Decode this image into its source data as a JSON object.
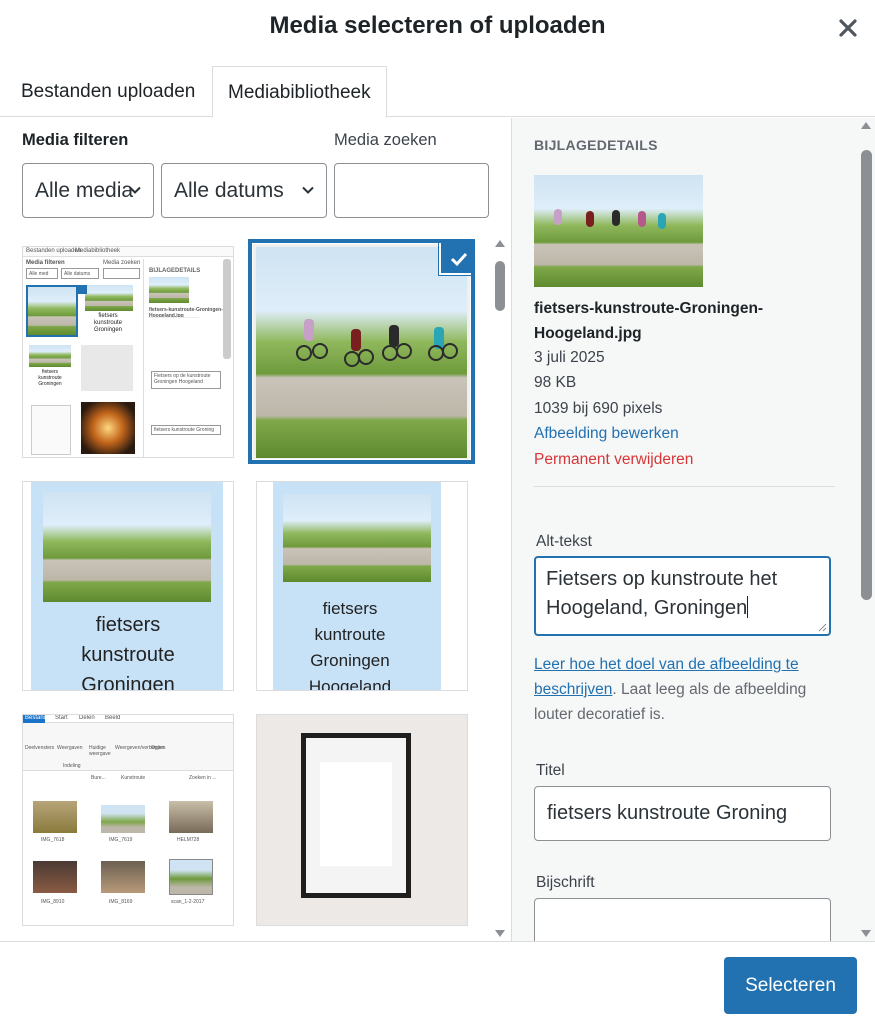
{
  "modal": {
    "title": "Media selecteren of uploaden",
    "close_icon": "close-icon"
  },
  "tabs": [
    {
      "label": "Bestanden uploaden",
      "active": false
    },
    {
      "label": "Mediabibliotheek",
      "active": true
    }
  ],
  "filters": {
    "filter_label": "Media filteren",
    "type_value": "Alle media",
    "date_value": "Alle datums",
    "search_label": "Media zoeken",
    "search_value": ""
  },
  "grid": {
    "items": [
      {
        "kind": "screenshot",
        "selected": false
      },
      {
        "kind": "photo-cyclists",
        "selected": true
      },
      {
        "kind": "poster",
        "text_lines": [
          "fietsers",
          "kunstroute",
          "Groningen"
        ],
        "selected": false
      },
      {
        "kind": "poster",
        "text_lines": [
          "fietsers",
          "kuntroute",
          "Groningen",
          "Hoogeland"
        ],
        "selected": false
      },
      {
        "kind": "explorer-screenshot",
        "selected": false
      },
      {
        "kind": "photo-frame",
        "selected": false
      }
    ],
    "explorer": {
      "tabs": [
        "Bestand",
        "Start",
        "Delen",
        "Beeld"
      ],
      "ribbon": [
        "Deelvensters",
        "Weergaven",
        "Huidige weergave",
        "Weergeven/verbergen",
        "Opties"
      ],
      "ribbon_group": "Indeling",
      "path": [
        "Bure...",
        "Kunstroute"
      ],
      "search": "Zoeken in ...",
      "files": [
        "IMG_7618",
        "IMG_7619",
        "HELM728",
        "IMG_8910",
        "IMG_8169",
        "scan_1-2-2017"
      ]
    },
    "mini": {
      "tabs": [
        "Bestanden uploaden",
        "Mediabibliotheek"
      ],
      "filter_label": "Media filteren",
      "search_label": "Media zoeken",
      "type_value": "Alle med",
      "date_value": "Alle datums",
      "details_head": "BIJLAGEDETAILS",
      "filename": "fietsers-kunstroute-Groningen-Hoogeland.jpg",
      "tile_text": [
        "fietsers",
        "kunstroute",
        "Groningen"
      ],
      "alt_text": "Fietsers op de kunstroute Groningen Hoogeland",
      "title": "fietsers kunstroute Groning"
    }
  },
  "details": {
    "heading": "BIJLAGEDETAILS",
    "filename": "fietsers-kunstroute-Groningen-Hoogeland.jpg",
    "date": "3 juli 2025",
    "size": "98 KB",
    "dimensions": "1039 bij 690 pixels",
    "edit_link": "Afbeelding bewerken",
    "delete_link": "Permanent verwijderen",
    "alt_label": "Alt-tekst",
    "alt_value": "Fietsers op kunstroute het Hoogeland, Groningen",
    "help_link": "Leer hoe het doel van de afbeelding te beschrijven",
    "help_text": ". Laat leeg als de afbeelding louter decoratief is.",
    "title_label": "Titel",
    "title_value": "fietsers kunstroute Groning",
    "caption_label": "Bijschrift",
    "caption_value": ""
  },
  "footer": {
    "select_button": "Selecteren"
  },
  "colors": {
    "accent": "#2271b1",
    "danger": "#d63638",
    "pane_bg": "#f6f7f7"
  }
}
